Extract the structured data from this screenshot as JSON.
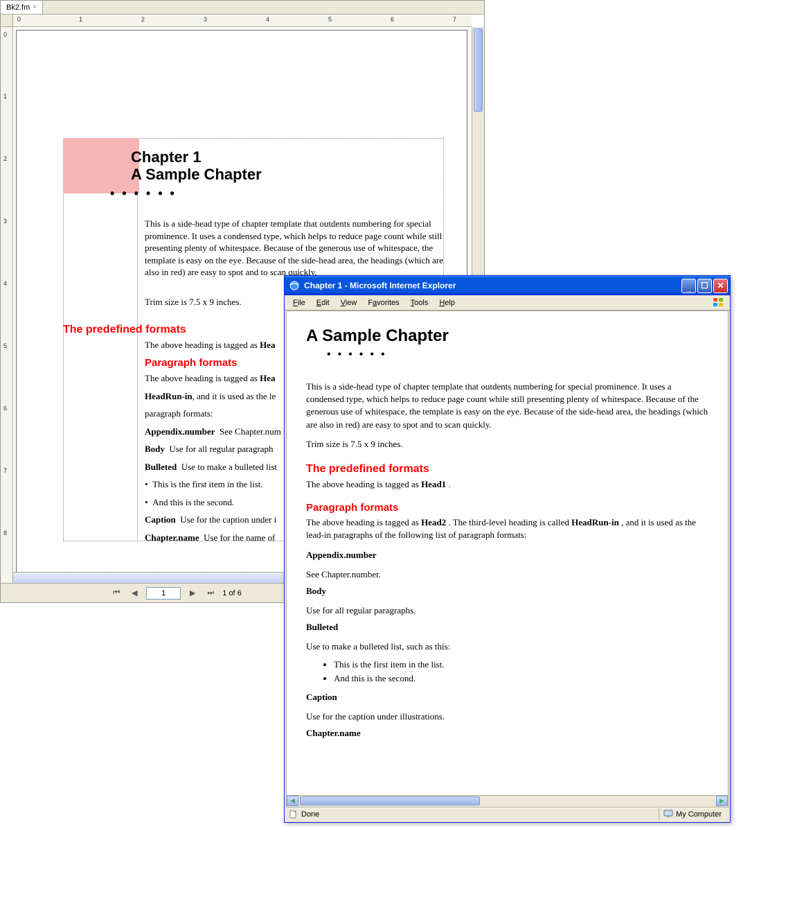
{
  "fm": {
    "tab": {
      "name": "Bk2.fm",
      "close": "×"
    },
    "ruler_h": [
      "0",
      "1",
      "2",
      "3",
      "4",
      "5",
      "6",
      "7"
    ],
    "ruler_v": [
      "0",
      "1",
      "2",
      "3",
      "4",
      "5",
      "6",
      "7",
      "8"
    ],
    "chapter_label": "Chapter 1",
    "chapter_title": "A Sample Chapter",
    "dots": "• • • • • •",
    "intro": "This is a side-head type of chapter template that outdents numbering for special prominence. It uses a condensed type, which helps to reduce page count while still presenting plenty of whitespace. Because of the generous use of whitespace, the template is easy on the eye. Because of the side-head area, the headings (which are also in red) are easy to spot and to scan quickly.",
    "trim": "Trim size is 7.5 x 9 inches.",
    "head1": "The predefined formats",
    "above1": "The above heading is tagged as ",
    "above1b": "Hea",
    "head2": "Paragraph formats",
    "above2": "The above heading is tagged as ",
    "above2b": "Hea",
    "runin_line_b": "HeadRun-in",
    "runin_line_rest": ", and it is used as the le",
    "pf_intro_tail": "paragraph formats:",
    "defs": [
      {
        "term": "Appendix.number",
        "body": "See Chapter.num"
      },
      {
        "term": "Body",
        "body": "Use for all regular paragraph"
      },
      {
        "term": "Bulleted",
        "body": "Use to make a bulleted list"
      }
    ],
    "bullets": [
      "This is the first item in the list.",
      "And this is the second."
    ],
    "caption_term": "Caption",
    "caption_body": "Use for the caption under i",
    "chname_term": "Chapter.name",
    "chname_body": "Use for the name of",
    "footer": {
      "page_input": "1",
      "page_total": "1 of 6"
    }
  },
  "ie": {
    "title": "Chapter 1 - Microsoft Internet Explorer",
    "menu": [
      "File",
      "Edit",
      "View",
      "Favorites",
      "Tools",
      "Help"
    ],
    "h1": "A Sample Chapter",
    "dots": "• • • • • •",
    "intro": "This is a side-head type of chapter template that outdents numbering for special prominence. It uses a condensed type, which helps to reduce page count while still presenting plenty of whitespace. Because of the generous use of whitespace, the template is easy on the eye. Because of the side-head area, the headings (which are also in red) are easy to spot and to scan quickly.",
    "trim": "Trim size is 7.5 x 9 inches.",
    "head1": "The predefined formats",
    "p_after_h1_a": "The above heading is tagged as ",
    "p_after_h1_b": "Head1",
    "p_after_h1_c": " .",
    "head2": "Paragraph formats",
    "p_after_h2_a": "The above heading is tagged as ",
    "p_after_h2_b": "Head2",
    "p_after_h2_c": " . The third-level heading is called ",
    "p_after_h2_d": "HeadRun-in",
    "p_after_h2_e": " , and it is used as the lead-in paragraphs of the following list of paragraph formats:",
    "defs": [
      {
        "term": "Appendix.number",
        "body": "See Chapter.number."
      },
      {
        "term": "Body",
        "body": "Use for all regular paragraphs."
      },
      {
        "term": "Bulleted",
        "body": "Use to make a bulleted list, such as this:"
      }
    ],
    "bullets": [
      "This is the first item in the list.",
      "And this is the second."
    ],
    "caption_term": "Caption",
    "caption_body": "Use for the caption under illustrations.",
    "chname_term": "Chapter.name",
    "status_left": "Done",
    "status_right": "My Computer"
  }
}
